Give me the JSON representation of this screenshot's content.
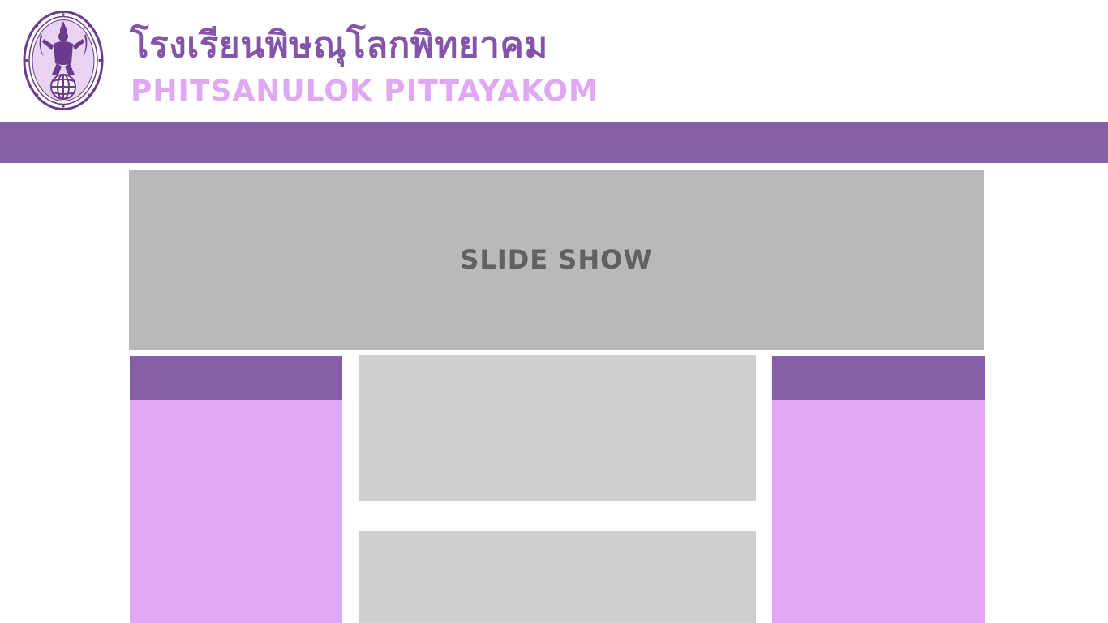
{
  "header": {
    "logo_icon": "school-emblem-icon",
    "school_name_th": "โรงเรียนพิษณุโลกพิทยาคม",
    "school_name_en": "PHITSANULOK PITTAYAKOM"
  },
  "slideshow": {
    "label": "SLIDE SHOW"
  },
  "colors": {
    "primary": "#865fa8",
    "accent_light": "#e0a8f4",
    "slideshow_bg": "#b9b9b9",
    "panel_bg": "#cfcfcf",
    "slideshow_text": "#616161"
  }
}
